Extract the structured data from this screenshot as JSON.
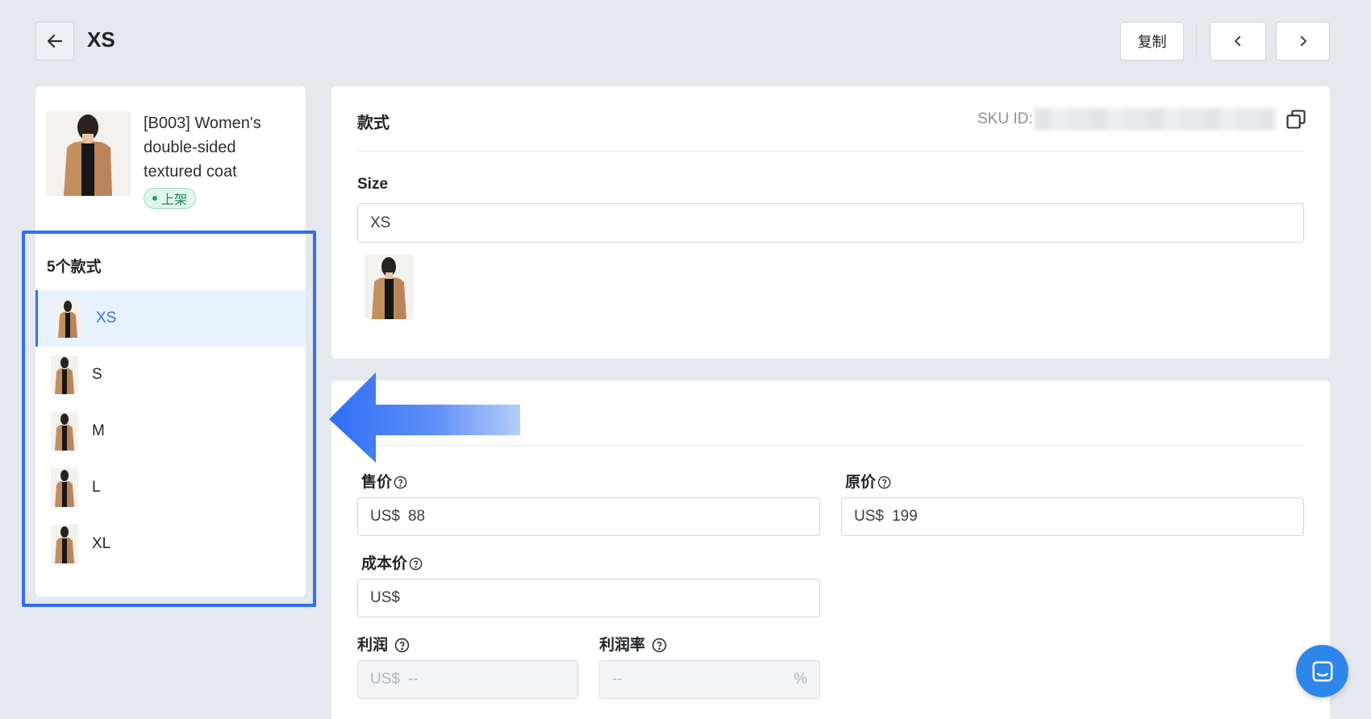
{
  "header": {
    "title": "XS",
    "copy_label": "复制",
    "back_icon": "arrow-left-icon",
    "prev_icon": "chevron-left-icon",
    "next_icon": "chevron-right-icon"
  },
  "product": {
    "name": "[B003] Women's double-sided textured coat",
    "status": "上架"
  },
  "variants": {
    "title": "5个款式",
    "items": [
      {
        "label": "XS",
        "active": true
      },
      {
        "label": "S",
        "active": false
      },
      {
        "label": "M",
        "active": false
      },
      {
        "label": "L",
        "active": false
      },
      {
        "label": "XL",
        "active": false
      }
    ]
  },
  "style_card": {
    "title": "款式",
    "sku_label": "SKU ID:",
    "size_label": "Size",
    "size_value": "XS"
  },
  "pricing": {
    "sale_price_label": "售价",
    "sale_currency": "US$",
    "sale_value": "88",
    "original_price_label": "原价",
    "original_currency": "US$",
    "original_value": "199",
    "cost_price_label": "成本价",
    "cost_currency": "US$",
    "cost_value": "",
    "profit_label": "利润",
    "profit_currency": "US$",
    "profit_value": "--",
    "margin_label": "利润率",
    "margin_value": "--",
    "margin_unit": "%"
  },
  "colors": {
    "accent": "#3b73d9",
    "highlight_border": "#2f6ff5",
    "status_green": "#1b8a4c",
    "chat_button": "#2f86ea"
  }
}
